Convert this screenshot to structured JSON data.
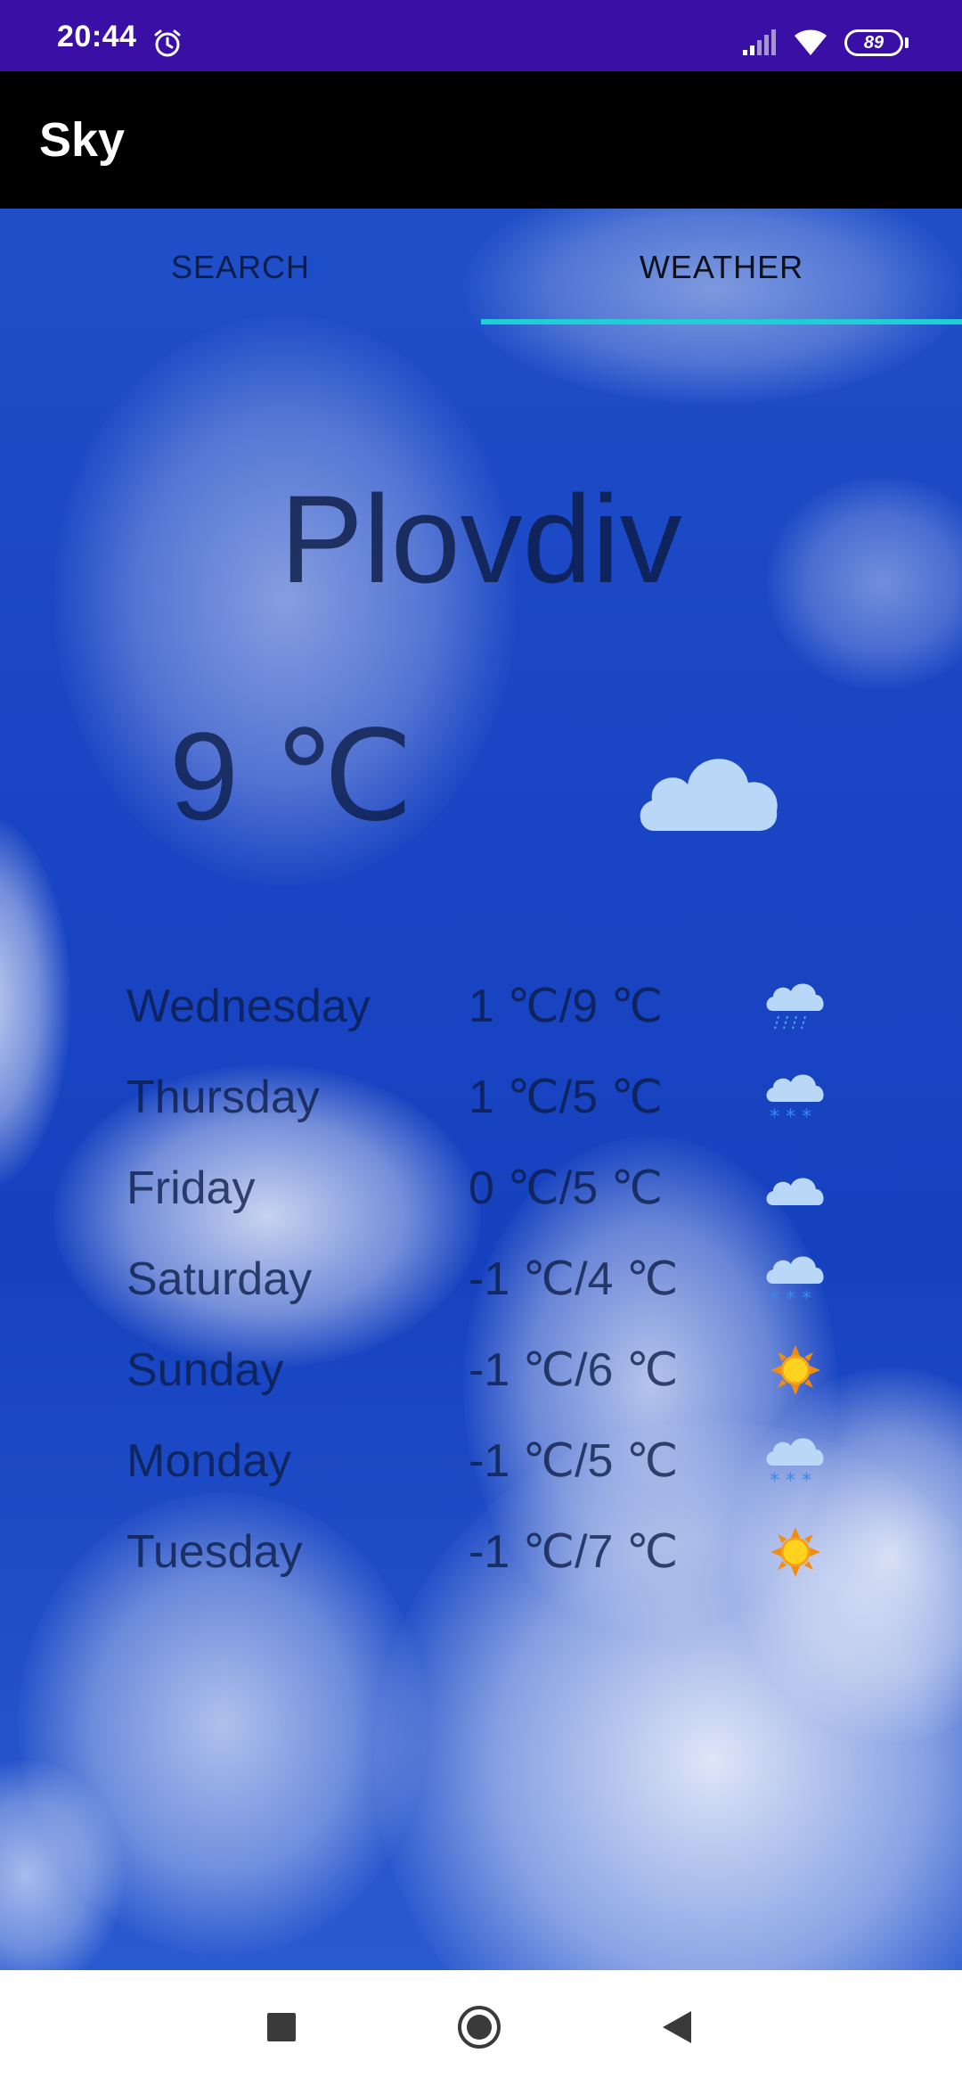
{
  "status_bar": {
    "time": "20:44",
    "battery": "89",
    "icons": [
      "alarm-icon",
      "signal-icon",
      "wifi-icon",
      "battery-icon"
    ]
  },
  "app_bar": {
    "title": "Sky"
  },
  "tabs": [
    {
      "label": "SEARCH",
      "selected": false
    },
    {
      "label": "WEATHER",
      "selected": true
    }
  ],
  "weather": {
    "city": "Plovdiv",
    "current_temp": "9 ℃",
    "current_icon": "cloud-icon"
  },
  "forecast": [
    {
      "day": "Wednesday",
      "temp": "1 ℃/9 ℃",
      "icon": "rain-icon"
    },
    {
      "day": "Thursday",
      "temp": "1 ℃/5 ℃",
      "icon": "snow-icon"
    },
    {
      "day": "Friday",
      "temp": "0 ℃/5 ℃",
      "icon": "cloud-icon"
    },
    {
      "day": "Saturday",
      "temp": "-1 ℃/4 ℃",
      "icon": "snow-icon"
    },
    {
      "day": "Sunday",
      "temp": "-1 ℃/6 ℃",
      "icon": "sun-icon"
    },
    {
      "day": "Monday",
      "temp": "-1 ℃/5 ℃",
      "icon": "snow-icon"
    },
    {
      "day": "Tuesday",
      "temp": "-1 ℃/7 ℃",
      "icon": "sun-icon"
    }
  ],
  "nav_bar": {
    "icons": [
      "recents-icon",
      "home-icon",
      "back-icon"
    ]
  },
  "colors": {
    "status_bar": "#3a0fa6",
    "app_bar": "#000000",
    "tab_indicator": "#1ed0d6",
    "sky": "#1a45c4"
  }
}
